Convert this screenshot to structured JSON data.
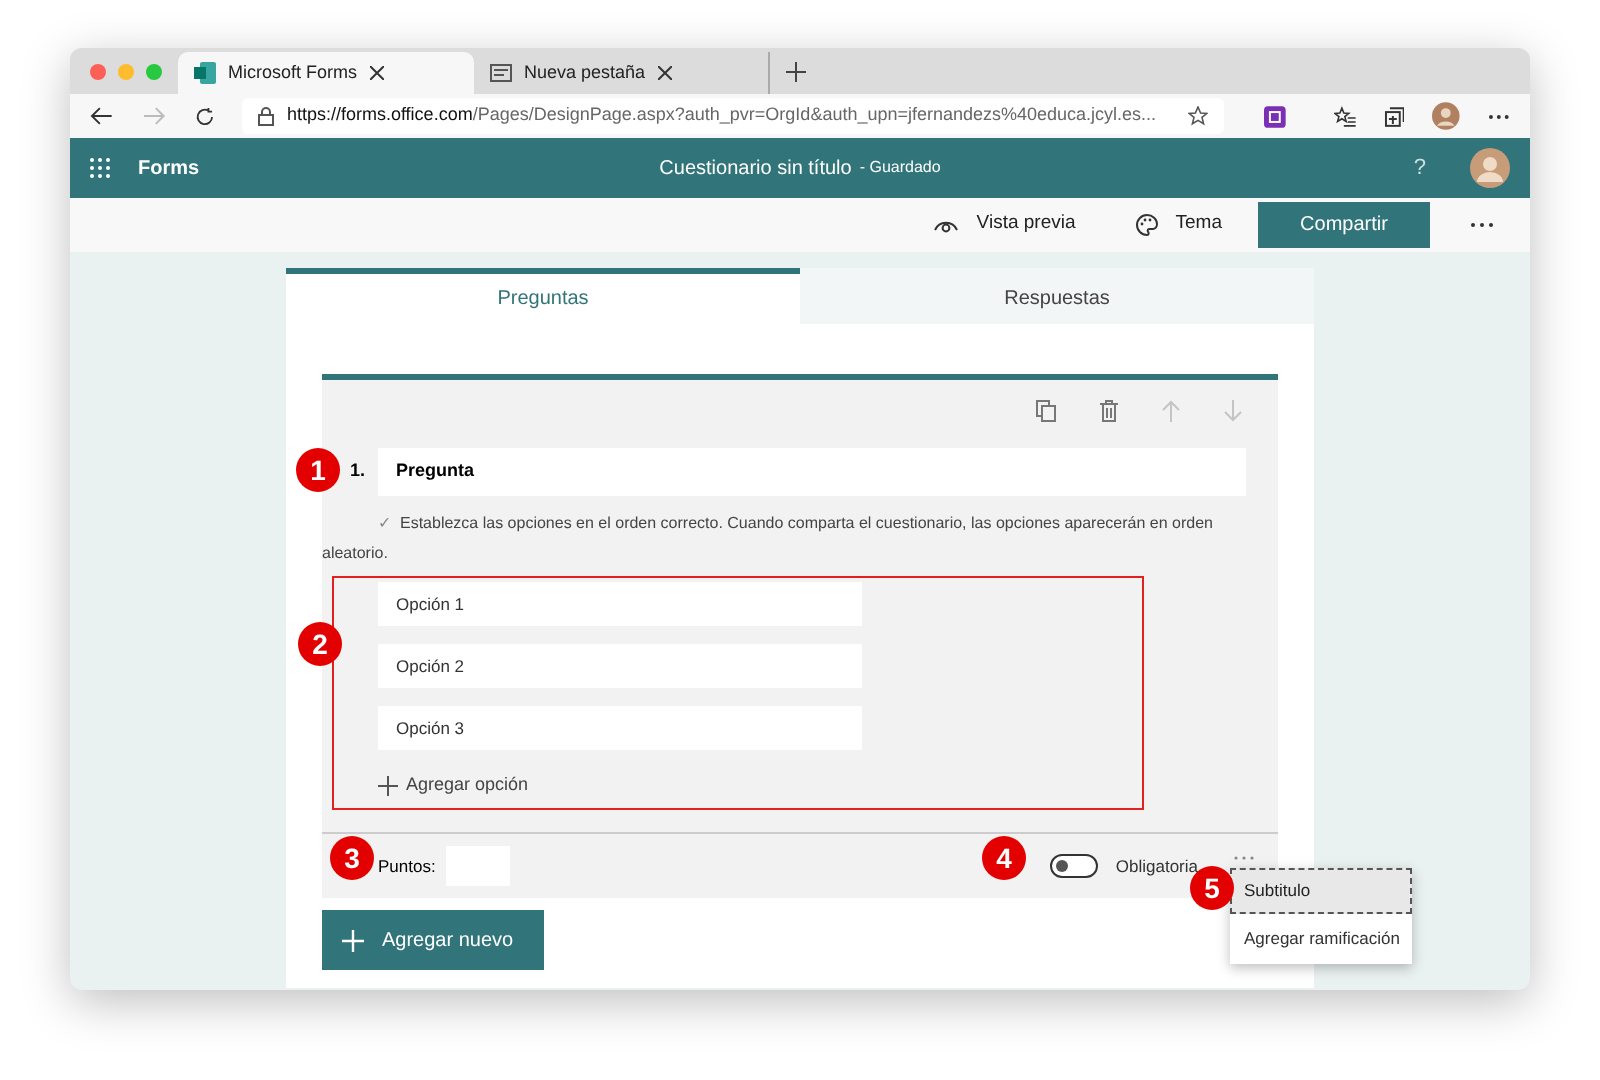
{
  "browser": {
    "tabs": [
      {
        "title": "Microsoft Forms",
        "selected": true
      },
      {
        "title": "Nueva pestaña",
        "selected": false
      }
    ],
    "url": {
      "host": "https://forms.office.com",
      "path": "/Pages/DesignPage.aspx?auth_pvr=OrgId&auth_upn=jfernandezs%40educa.jcyl.es..."
    }
  },
  "app": {
    "name": "Forms",
    "title": "Cuestionario sin título",
    "save_status": "- Guardado",
    "help": "?"
  },
  "commands": [
    {
      "kind": "preview",
      "label": "Vista previa"
    },
    {
      "kind": "theme",
      "label": "Tema"
    }
  ],
  "share_button": "Compartir",
  "tabs": [
    {
      "label": "Preguntas",
      "selected": true
    },
    {
      "label": "Respuestas",
      "selected": false
    }
  ],
  "question": {
    "number": "1.",
    "title": "Pregunta",
    "hint_mark": "✓",
    "hint": "Establezca las opciones en el orden correcto. Cuando comparta el cuestionario, las opciones aparecerán en orden aleatorio.",
    "options": [
      "Opción 1",
      "Opción 2",
      "Opción 3"
    ],
    "add_option": "Agregar opción",
    "points_label": "Puntos:",
    "required": {
      "label": "Obligatoria",
      "on": false
    }
  },
  "add_new": "Agregar nuevo",
  "menu": [
    {
      "label": "Subtitulo",
      "selected": true
    },
    {
      "label": "Agregar ramificación",
      "selected": false
    }
  ],
  "annotations": [
    "1",
    "2",
    "3",
    "4",
    "5"
  ]
}
